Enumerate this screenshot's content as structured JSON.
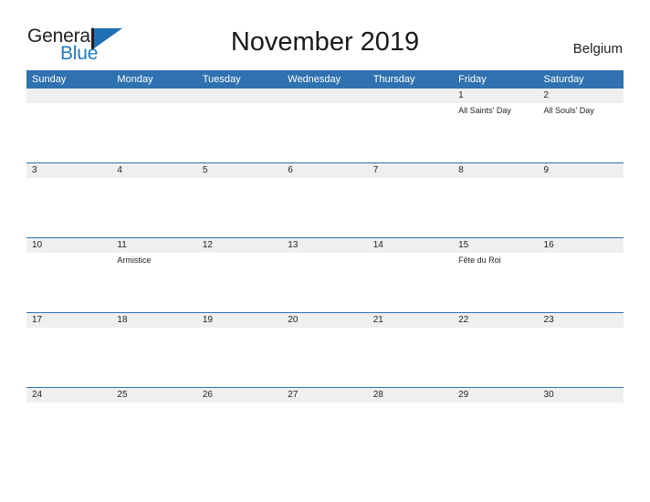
{
  "brand": {
    "name_part1": "General",
    "name_part2": "Blue",
    "mark_icon": "triangle-flag-icon",
    "accent_color": "#1f7cc4"
  },
  "header": {
    "title": "November 2019",
    "locale": "Belgium"
  },
  "theme": {
    "header_blue": "#3072b0",
    "band_gray": "#efefef",
    "rule_blue": "#3072b0",
    "text_dark": "#1f1f1f"
  },
  "calendar": {
    "weekday_headers": [
      "Sunday",
      "Monday",
      "Tuesday",
      "Wednesday",
      "Thursday",
      "Friday",
      "Saturday"
    ],
    "weeks": [
      {
        "days": [
          {
            "number": "",
            "event": "",
            "empty": true
          },
          {
            "number": "",
            "event": "",
            "empty": true
          },
          {
            "number": "",
            "event": "",
            "empty": true
          },
          {
            "number": "",
            "event": "",
            "empty": true
          },
          {
            "number": "",
            "event": "",
            "empty": true
          },
          {
            "number": "1",
            "event": "All Saints' Day",
            "empty": false
          },
          {
            "number": "2",
            "event": "All Souls' Day",
            "empty": false
          }
        ]
      },
      {
        "days": [
          {
            "number": "3",
            "event": "",
            "empty": false
          },
          {
            "number": "4",
            "event": "",
            "empty": false
          },
          {
            "number": "5",
            "event": "",
            "empty": false
          },
          {
            "number": "6",
            "event": "",
            "empty": false
          },
          {
            "number": "7",
            "event": "",
            "empty": false
          },
          {
            "number": "8",
            "event": "",
            "empty": false
          },
          {
            "number": "9",
            "event": "",
            "empty": false
          }
        ]
      },
      {
        "days": [
          {
            "number": "10",
            "event": "",
            "empty": false
          },
          {
            "number": "11",
            "event": "Armistice",
            "empty": false
          },
          {
            "number": "12",
            "event": "",
            "empty": false
          },
          {
            "number": "13",
            "event": "",
            "empty": false
          },
          {
            "number": "14",
            "event": "",
            "empty": false
          },
          {
            "number": "15",
            "event": "Fête du Roi",
            "empty": false
          },
          {
            "number": "16",
            "event": "",
            "empty": false
          }
        ]
      },
      {
        "days": [
          {
            "number": "17",
            "event": "",
            "empty": false
          },
          {
            "number": "18",
            "event": "",
            "empty": false
          },
          {
            "number": "19",
            "event": "",
            "empty": false
          },
          {
            "number": "20",
            "event": "",
            "empty": false
          },
          {
            "number": "21",
            "event": "",
            "empty": false
          },
          {
            "number": "22",
            "event": "",
            "empty": false
          },
          {
            "number": "23",
            "event": "",
            "empty": false
          }
        ]
      },
      {
        "days": [
          {
            "number": "24",
            "event": "",
            "empty": false
          },
          {
            "number": "25",
            "event": "",
            "empty": false
          },
          {
            "number": "26",
            "event": "",
            "empty": false
          },
          {
            "number": "27",
            "event": "",
            "empty": false
          },
          {
            "number": "28",
            "event": "",
            "empty": false
          },
          {
            "number": "29",
            "event": "",
            "empty": false
          },
          {
            "number": "30",
            "event": "",
            "empty": false
          }
        ]
      }
    ]
  }
}
